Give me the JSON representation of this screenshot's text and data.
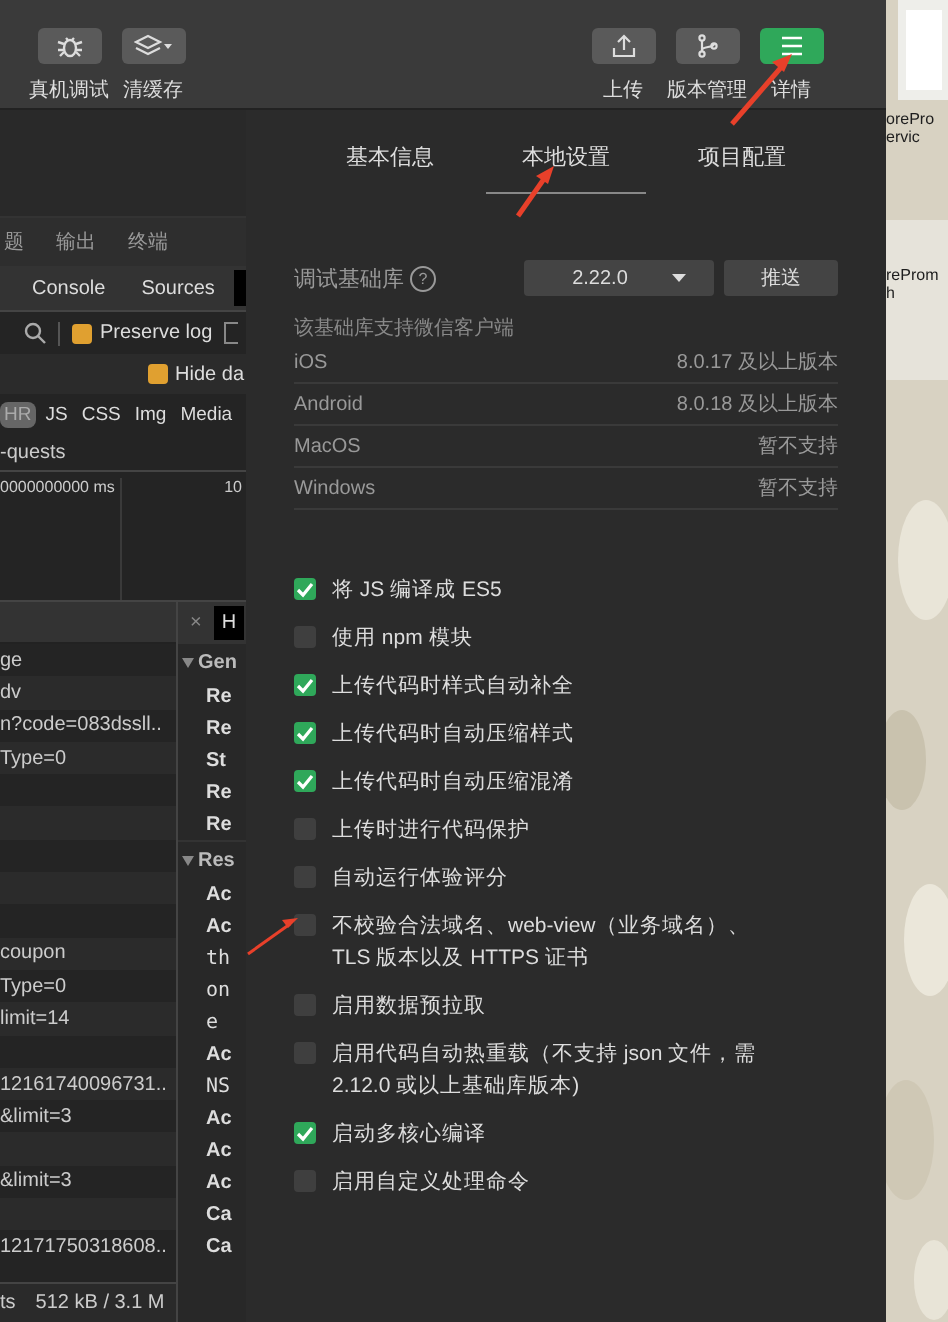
{
  "toolbar": {
    "left_buttons": [
      {
        "label": "真机调试",
        "kind": "bug"
      },
      {
        "label": "清缓存",
        "kind": "layers"
      }
    ],
    "right_buttons": [
      {
        "label": "上传",
        "kind": "upload",
        "selected": false
      },
      {
        "label": "版本管理",
        "kind": "branch",
        "selected": false
      },
      {
        "label": "详情",
        "kind": "menu",
        "selected": true
      }
    ]
  },
  "devtools": {
    "panel_tabs": [
      "题",
      "输出",
      "终端"
    ],
    "tabs": [
      "Console",
      "Sources"
    ],
    "preserve_log": {
      "label": "Preserve log",
      "checked": true
    },
    "filter_checkbox": {
      "checked": false
    },
    "hide_data": {
      "label": "Hide da",
      "checked": true
    },
    "filters": [
      {
        "label": "HR",
        "selected": true
      },
      {
        "label": "JS",
        "selected": false
      },
      {
        "label": "CSS",
        "selected": false
      },
      {
        "label": "Img",
        "selected": false
      },
      {
        "label": "Media",
        "selected": false
      }
    ],
    "requests_label": "-quests",
    "timeline": [
      "0000000000 ms",
      "10"
    ],
    "detail_tab": {
      "close": "×",
      "label": "H"
    },
    "rows": [
      {
        "kind": "request",
        "name": "ge"
      },
      {
        "kind": "request",
        "name": "dv"
      },
      {
        "kind": "request",
        "name": "n?code=083dssll.."
      },
      {
        "kind": "request",
        "name": "Type=0"
      },
      {
        "kind": "blank"
      },
      {
        "kind": "blank"
      },
      {
        "kind": "blank"
      },
      {
        "kind": "blank"
      },
      {
        "kind": "blank"
      },
      {
        "kind": "request",
        "name": "coupon"
      },
      {
        "kind": "request",
        "name": "Type=0"
      },
      {
        "kind": "request",
        "name": "limit=14"
      },
      {
        "kind": "blank"
      },
      {
        "kind": "request",
        "name": "12161740096731.."
      },
      {
        "kind": "request",
        "name": "&limit=3"
      },
      {
        "kind": "blank"
      },
      {
        "kind": "request",
        "name": "&limit=3"
      },
      {
        "kind": "blank"
      },
      {
        "kind": "request",
        "name": "12171750318608.."
      }
    ],
    "status": [
      "ts",
      "512 kB / 3.1 M"
    ],
    "details": [
      {
        "kind": "section",
        "text": "Gen"
      },
      {
        "kind": "key",
        "text": "Re"
      },
      {
        "kind": "key",
        "text": "Re"
      },
      {
        "kind": "key",
        "text": "St"
      },
      {
        "kind": "key",
        "text": "Re"
      },
      {
        "kind": "key",
        "text": "Re"
      },
      {
        "kind": "section",
        "text": "Res"
      },
      {
        "kind": "key",
        "text": "Ac"
      },
      {
        "kind": "key",
        "text": "Ac"
      },
      {
        "kind": "value",
        "text": "th"
      },
      {
        "kind": "value",
        "text": "on"
      },
      {
        "kind": "value",
        "text": "e"
      },
      {
        "kind": "key",
        "text": "Ac"
      },
      {
        "kind": "value",
        "text": "NS"
      },
      {
        "kind": "key",
        "text": "Ac"
      },
      {
        "kind": "key",
        "text": "Ac"
      },
      {
        "kind": "key",
        "text": "Ac"
      },
      {
        "kind": "key",
        "text": "Ca"
      },
      {
        "kind": "key",
        "text": "Ca"
      }
    ]
  },
  "settings": {
    "tabs": [
      {
        "label": "基本信息",
        "selected": false
      },
      {
        "label": "本地设置",
        "selected": true
      },
      {
        "label": "项目配置",
        "selected": false
      }
    ],
    "library": {
      "label": "调试基础库",
      "help": "?",
      "version": "2.22.0",
      "push": "推送"
    },
    "support_note": "该基础库支持微信客户端",
    "platforms": [
      {
        "name": "iOS",
        "value": "8.0.17 及以上版本"
      },
      {
        "name": "Android",
        "value": "8.0.18 及以上版本"
      },
      {
        "name": "MacOS",
        "value": "暂不支持"
      },
      {
        "name": "Windows",
        "value": "暂不支持"
      }
    ],
    "options": [
      {
        "label": "将 JS 编译成 ES5",
        "checked": true
      },
      {
        "label": "使用 npm 模块",
        "checked": false
      },
      {
        "label": "上传代码时样式自动补全",
        "checked": true
      },
      {
        "label": "上传代码时自动压缩样式",
        "checked": true
      },
      {
        "label": "上传代码时自动压缩混淆",
        "checked": true
      },
      {
        "label": "上传时进行代码保护",
        "checked": false
      },
      {
        "label": "自动运行体验评分",
        "checked": false
      },
      {
        "label": "不校验合法域名、web-view（业务域名）、TLS 版本以及 HTTPS 证书",
        "checked": false
      },
      {
        "label": "启用数据预拉取",
        "checked": false
      },
      {
        "label": "启用代码自动热重载（不支持 json 文件，需 2.12.0 或以上基础库版本)",
        "checked": false
      },
      {
        "label": "启动多核心编译",
        "checked": true
      },
      {
        "label": "启用自定义处理命令",
        "checked": false
      }
    ]
  },
  "desktop": {
    "labels": [
      "orePro",
      "ervic",
      "reProm",
      "h"
    ]
  }
}
